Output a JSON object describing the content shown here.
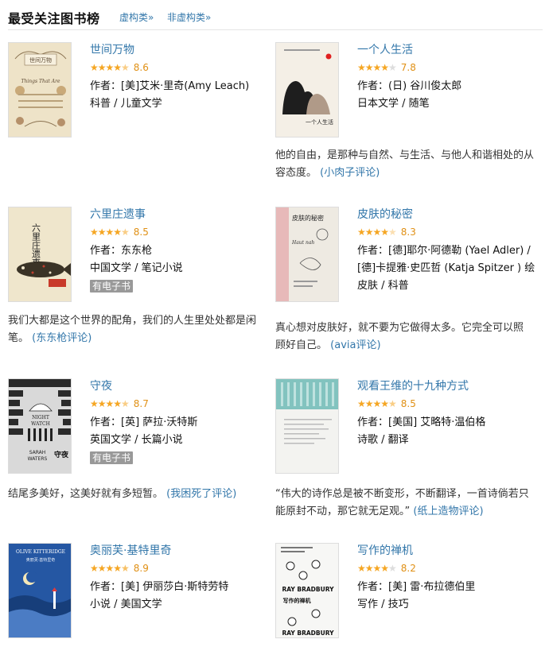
{
  "header": {
    "title": "最受关注图书榜",
    "tab_fiction": "虚构类»",
    "tab_nonfiction": "非虚构类»"
  },
  "colors": {
    "link": "#3377aa",
    "star": "#f5a623",
    "score": "#e09015",
    "badge": "#999999"
  },
  "books": [
    {
      "title": "世间万物",
      "stars": 4.5,
      "score": "8.6",
      "author": "作者：[美]艾米·里奇(Amy Leach)",
      "category": "科普 / 儿童文学",
      "ebook": "",
      "quote": "",
      "reviewer": ""
    },
    {
      "title": "一个人生活",
      "stars": 4,
      "score": "7.8",
      "author": "作者：(日) 谷川俊太郎",
      "category": "日本文学 / 随笔",
      "ebook": "",
      "quote": "他的自由，是那种与自然、与生活、与他人和谐相处的从容态度。",
      "reviewer": "(小肉子评论)"
    },
    {
      "title": "六里庄遗事",
      "stars": 4.5,
      "score": "8.5",
      "author": "作者：东东枪",
      "category": "中国文学 / 笔记小说",
      "ebook": "有电子书",
      "quote": "我们大都是这个世界的配角，我们的人生里处处都是闲笔。",
      "reviewer": "(东东枪评论)"
    },
    {
      "title": "皮肤的秘密",
      "stars": 4,
      "score": "8.3",
      "author": "作者：[德]耶尔·阿德勒 (Yael Adler) / [德]卡提雅·史匹哲 (Katja Spitzer ) 绘",
      "category": "皮肤 / 科普",
      "ebook": "",
      "quote": "真心想对皮肤好，就不要为它做得太多。它完全可以照顾好自己。",
      "reviewer": "(avia评论)"
    },
    {
      "title": "守夜",
      "stars": 4.5,
      "score": "8.7",
      "author": "作者：[英] 萨拉·沃特斯",
      "category": "英国文学 / 长篇小说",
      "ebook": "有电子书",
      "quote": "结尾多美好，这美好就有多短暂。",
      "reviewer": "(我困死了评论)"
    },
    {
      "title": "观看王维的十九种方式",
      "stars": 4.5,
      "score": "8.5",
      "author": "作者：[美国] 艾略特·温伯格",
      "category": "诗歌 / 翻译",
      "ebook": "",
      "quote": "“伟大的诗作总是被不断变形，不断翻译，一首诗倘若只能原封不动，那它就无足观。”",
      "reviewer": "(纸上造物评论)"
    },
    {
      "title": "奥丽芙·基特里奇",
      "stars": 4.5,
      "score": "8.9",
      "author": "作者：[美] 伊丽莎白·斯特劳特",
      "category": "小说 / 美国文学",
      "ebook": "",
      "quote": "",
      "reviewer": ""
    },
    {
      "title": "写作的禅机",
      "stars": 4,
      "score": "8.2",
      "author": "作者：[美] 雷·布拉德伯里",
      "category": "写作 / 技巧",
      "ebook": "",
      "quote": "",
      "reviewer": ""
    }
  ],
  "cover_text": {
    "book1": [
      "世间万物",
      "Things That Are"
    ],
    "book2": [
      "一个人生活"
    ],
    "book3": [
      "六里庄遗事"
    ],
    "book4": [
      "皮肤的秘密",
      "Haut nah"
    ],
    "book5": [
      "NIGHT",
      "WATCH",
      "SARAH",
      "WATERS",
      "守夜"
    ],
    "book6": [],
    "book7": [
      "OLIVE KITTERIDGE",
      "奥丽芙·基特里奇"
    ],
    "book8": [
      "RAY BRADBURY",
      "写作的禅机",
      "RAY BRADBURY"
    ]
  }
}
